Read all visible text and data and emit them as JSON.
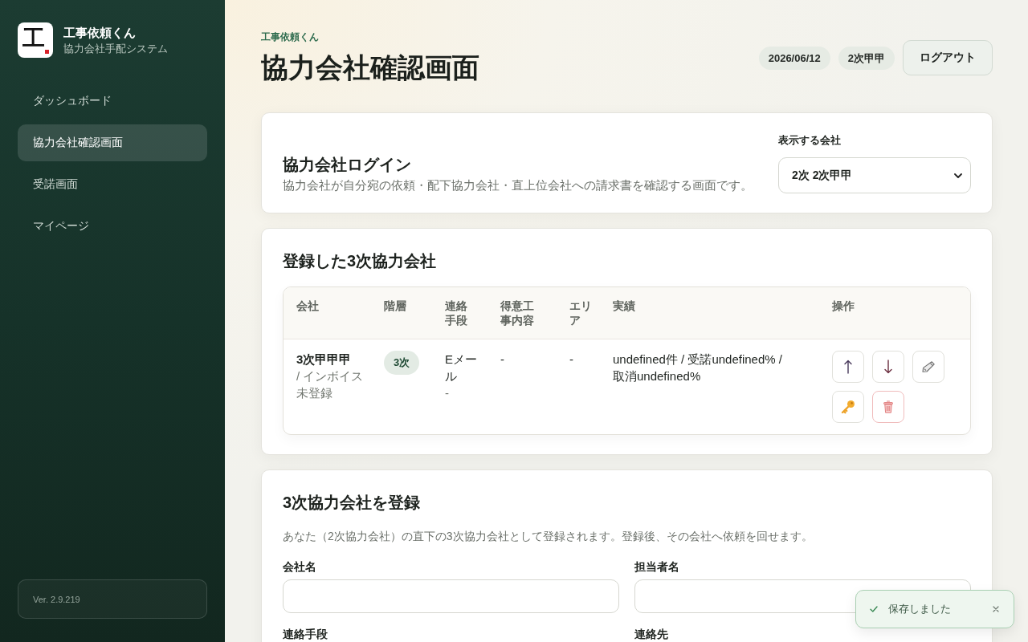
{
  "sidebar": {
    "brand": {
      "logo_mark": "工",
      "name": "工事依頼くん",
      "subtitle": "協力会社手配システム"
    },
    "nav": [
      {
        "label": "ダッシュボード",
        "selected": false
      },
      {
        "label": "協力会社確認画面",
        "selected": true
      },
      {
        "label": "受諾画面",
        "selected": false
      },
      {
        "label": "マイページ",
        "selected": false
      }
    ],
    "version": "Ver. 2.9.219"
  },
  "header": {
    "eyebrow": "工事依頼くん",
    "title": "協力会社確認画面",
    "badges": [
      "2026/06/12",
      "2次甲甲"
    ],
    "logout": "ログアウト"
  },
  "login_card": {
    "title": "協力会社ログイン",
    "description": "協力会社が自分宛の依頼・配下協力会社・直上位会社への請求書を確認する画面です。",
    "select_label": "表示する会社",
    "select_value": "2次 2次甲甲"
  },
  "registered_card": {
    "title": "登録した3次協力会社",
    "table": {
      "columns": [
        "会社",
        "階層",
        "連絡手段",
        "得意工事内容",
        "エリア",
        "実績",
        "操作"
      ],
      "rows": [
        {
          "company": "3次甲甲甲",
          "invoice": "/ インボイス未登録",
          "tier": "3次",
          "contact_method": "Eメール",
          "contact": "-",
          "specialty": "-",
          "area": "-",
          "record": "undefined件 / 受諾undefined% / 取消undefined%",
          "actions": [
            {
              "kind": "up"
            },
            {
              "kind": "down"
            },
            {
              "kind": "edit"
            },
            {
              "kind": "key"
            },
            {
              "kind": "delete"
            }
          ]
        }
      ]
    }
  },
  "register_card": {
    "title": "3次協力会社を登録",
    "description": "あなた（2次協力会社）の直下の3次協力会社として登録されます。登録後、その会社へ依頼を回せます。",
    "fields": [
      {
        "label": "会社名",
        "kind": "input"
      },
      {
        "label": "担当者名",
        "kind": "input"
      },
      {
        "label": "連絡手段",
        "kind": "label"
      },
      {
        "label": "連絡先",
        "kind": "label"
      }
    ]
  },
  "toast": {
    "message": "保存しました"
  }
}
